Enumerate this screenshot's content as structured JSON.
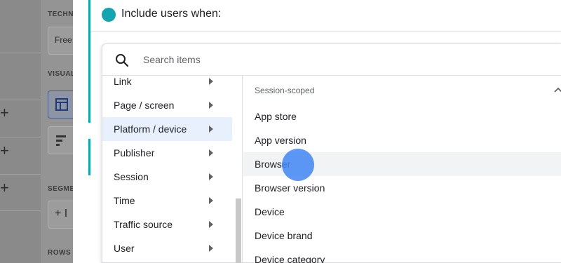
{
  "background_panel": {
    "section_labels": [
      "TECHN",
      "VISUAL",
      "SEGME",
      "ROWS"
    ],
    "technique_value": "Free",
    "segment_add_label": "+ I",
    "plus_glyph": "+"
  },
  "header": {
    "title": "Include users when:",
    "accent_color": "#12a4af"
  },
  "search": {
    "placeholder": "Search items",
    "icon": "search-icon"
  },
  "categories": [
    {
      "label": "Link"
    },
    {
      "label": "Page / screen"
    },
    {
      "label": "Platform / device",
      "selected": true
    },
    {
      "label": "Publisher"
    },
    {
      "label": "Session"
    },
    {
      "label": "Time"
    },
    {
      "label": "Traffic source"
    },
    {
      "label": "User"
    }
  ],
  "items": {
    "heading": "Session-scoped",
    "list": [
      {
        "label": "App store"
      },
      {
        "label": "App version"
      },
      {
        "label": "Browser",
        "hovered": true
      },
      {
        "label": "Browser version"
      },
      {
        "label": "Device"
      },
      {
        "label": "Device brand"
      },
      {
        "label": "Device category"
      }
    ]
  }
}
